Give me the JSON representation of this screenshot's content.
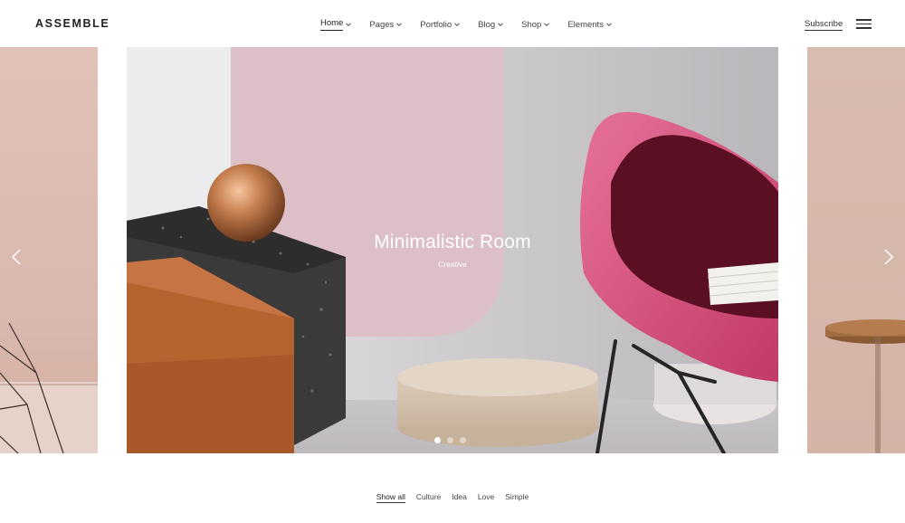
{
  "header": {
    "logo": "ASSEMBLE",
    "nav": [
      {
        "label": "Home",
        "active": true
      },
      {
        "label": "Pages",
        "active": false
      },
      {
        "label": "Portfolio",
        "active": false
      },
      {
        "label": "Blog",
        "active": false
      },
      {
        "label": "Shop",
        "active": false
      },
      {
        "label": "Elements",
        "active": false
      }
    ],
    "subscribe": "Subscribe",
    "menu_icon": "hamburger-icon"
  },
  "slider": {
    "title": "Minimalistic Room",
    "subtitle": "Creative",
    "dots": 3,
    "active_dot": 1,
    "prev_icon": "chevron-left-icon",
    "next_icon": "chevron-right-icon"
  },
  "filters": [
    "Show all",
    "Culture",
    "Idea",
    "Love",
    "Simple"
  ],
  "colors": {
    "text": "#222222",
    "accent_pink": "#d64c7a",
    "wall_pink": "#dcbcc6",
    "copper": "#c37a4e"
  }
}
